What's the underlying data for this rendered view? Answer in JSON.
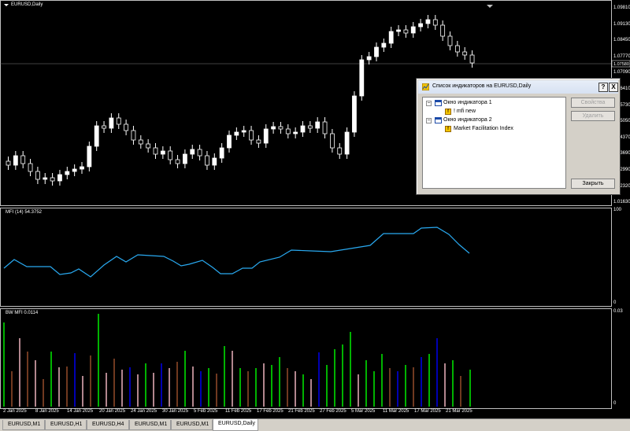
{
  "main_chart": {
    "symbol_label": "EURUSD,Daily",
    "price_scale": [
      "1.09810",
      "1.09130",
      "1.08450",
      "1.07770",
      "1.07090",
      "1.06410",
      "1.05730",
      "1.05050",
      "1.04370",
      "1.03690",
      "1.02990",
      "1.02320",
      "1.01630"
    ],
    "current_price": "1.07580"
  },
  "mfi_pane": {
    "label": "MFI (14) 54.3752",
    "scale_max": "100",
    "scale_min": "0",
    "line_color": "#29a9f0"
  },
  "bwmfi_pane": {
    "label": "BW MFI 0.0114",
    "scale_max": "0.03",
    "scale_min": "0",
    "colors": {
      "green": "#00ff00",
      "brown": "#a0522d",
      "blue": "#0000ff",
      "pink": "#ffc0cb"
    }
  },
  "date_axis": [
    "2 Jan 2025",
    "8 Jan 2025",
    "14 Jan 2025",
    "20 Jan 2025",
    "24 Jan 2025",
    "30 Jan 2025",
    "5 Feb 2025",
    "11 Feb 2025",
    "17 Feb 2025",
    "21 Feb 2025",
    "27 Feb 2025",
    "5 Mar 2025",
    "11 Mar 2025",
    "17 Mar 2025",
    "21 Mar 2025"
  ],
  "tabs": [
    "EURUSD,M1",
    "EURUSD,H1",
    "EURUSD,H4",
    "EURUSD,M1",
    "EURUSD,M1",
    "EURUSD,Daily"
  ],
  "active_tab": 5,
  "dialog": {
    "title": "Список индикаторов на EURUSD,Daily",
    "help_button": "?",
    "close_button": "X",
    "tree": {
      "window1": "Окно индикатора 1",
      "window1_item": "! mfi new",
      "window2": "Окно индикатора 2",
      "window2_item": "Market Facilitation Index"
    },
    "properties_button": "Свойства",
    "delete_button": "Удалить",
    "close_label": "Закрыть"
  }
}
